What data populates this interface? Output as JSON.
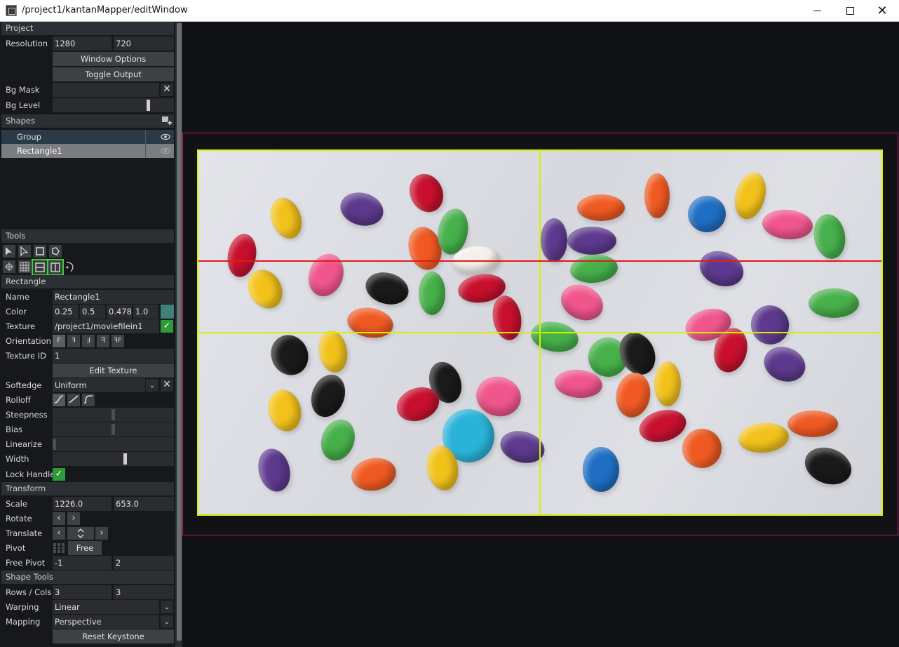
{
  "window": {
    "title": "/project1/kantanMapper/editWindow"
  },
  "project": {
    "header": "Project",
    "resolution_label": "Resolution",
    "res_w": "1280",
    "res_h": "720",
    "window_options": "Window Options",
    "toggle_output": "Toggle Output",
    "bg_mask_label": "Bg Mask",
    "bg_level_label": "Bg Level",
    "bg_level_value": 0.8
  },
  "shapes": {
    "header": "Shapes",
    "items": [
      {
        "label": "Group"
      },
      {
        "label": "Rectangle1"
      }
    ]
  },
  "tools": {
    "header": "Tools"
  },
  "rectangle": {
    "header": "Rectangle",
    "name_label": "Name",
    "name_value": "Rectangle1",
    "color_label": "Color",
    "color_r": "0.25",
    "color_g": "0.5",
    "color_b": "0.478",
    "color_a": "1.0",
    "color_swatch": "#40807a",
    "texture_label": "Texture",
    "texture_value": "/project1/moviefilein1",
    "orientation_label": "Orientation",
    "texture_id_label": "Texture ID",
    "texture_id_value": "1",
    "edit_texture": "Edit Texture",
    "softedge_label": "Softedge",
    "softedge_value": "Uniform",
    "rolloff_label": "Rolloff",
    "steepness_label": "Steepness",
    "bias_label": "Bias",
    "linearize_label": "Linearize",
    "width_label": "Width",
    "width_value": 0.6,
    "lock_handle_label": "Lock Handle"
  },
  "transform": {
    "header": "Transform",
    "scale_label": "Scale",
    "scale_x": "1226.0",
    "scale_y": "653.0",
    "rotate_label": "Rotate",
    "translate_label": "Translate",
    "pivot_label": "Pivot",
    "pivot_value": "Free",
    "free_pivot_label": "Free Pivot",
    "free_pivot_x": "-1",
    "free_pivot_y": "2"
  },
  "shape_tools": {
    "header": "Shape Tools",
    "rows_cols_label": "Rows / Cols",
    "rows": "3",
    "cols": "3",
    "warping_label": "Warping",
    "warping_value": "Linear",
    "mapping_label": "Mapping",
    "mapping_value": "Perspective",
    "reset_keystone": "Reset Keystone"
  },
  "colors": {
    "grid_line": "#d8f000",
    "output_border": "#c0186a",
    "selected_handle": "#e21a1a",
    "tool_selected": "#39d42b"
  }
}
